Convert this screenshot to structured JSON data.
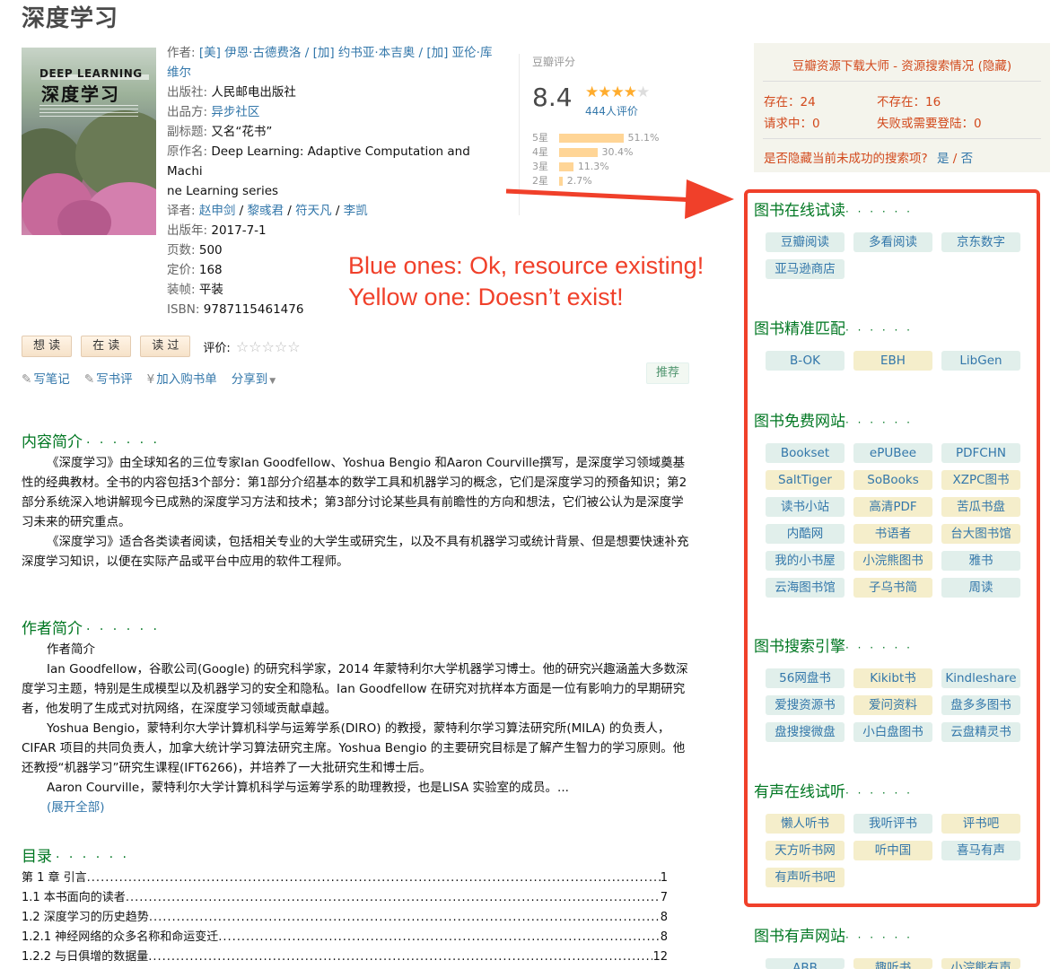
{
  "title": "深度学习",
  "cover": {
    "line1": "DEEP LEARNING",
    "line2": "深度学习"
  },
  "info": {
    "author_label": "作者:",
    "authors": "[美] 伊恩·古德费洛 / [加] 约书亚·本吉奥 / [加] 亚伦·库维尔",
    "authors_line1": "[美] 伊恩·古德费洛 / [加] 约书亚·本吉奥 / [加] 亚伦·库",
    "authors_line2": "维尔",
    "publisher_label": "出版社:",
    "publisher": "人民邮电出版社",
    "producer_label": "出品方:",
    "producer": "异步社区",
    "subtitle_label": "副标题:",
    "subtitle": "又名“花书”",
    "original_label": "原作名:",
    "original_line1": "Deep Learning: Adaptive Computation and Machi",
    "original_line2": "ne Learning series",
    "translator_label": "译者:",
    "translators": [
      "赵申剑",
      "黎彧君",
      "符天凡",
      "李凯"
    ],
    "pubyear_label": "出版年:",
    "pubyear": "2017-7-1",
    "pages_label": "页数:",
    "pages": "500",
    "price_label": "定价:",
    "price": "168",
    "binding_label": "装帧:",
    "binding": "平装",
    "isbn_label": "ISBN:",
    "isbn": "9787115461476"
  },
  "rating": {
    "label": "豆瓣评分",
    "score": "8.4",
    "stars": 4.5,
    "count": "444人评价",
    "bars": [
      {
        "label": "5星",
        "pct": "51.1%",
        "value": 51.1
      },
      {
        "label": "4星",
        "pct": "30.4%",
        "value": 30.4
      },
      {
        "label": "3星",
        "pct": "11.3%",
        "value": 11.3
      },
      {
        "label": "2星",
        "pct": "2.7%",
        "value": 2.7
      }
    ]
  },
  "actions": {
    "want": "想 读",
    "reading": "在 读",
    "read": "读 过",
    "rate": "评价:"
  },
  "tools": {
    "note": "写笔记",
    "review": "写书评",
    "cart": "加入购书单",
    "share": "分享到",
    "recommend": "推荐"
  },
  "intro": {
    "heading": "内容简介",
    "dots": "· · · · · ·",
    "p1": "《深度学习》由全球知名的三位专家Ian Goodfellow、Yoshua Bengio 和Aaron Courville撰写，是深度学习领域奠基性的经典教材。全书的内容包括3个部分：第1部分介绍基本的数学工具和机器学习的概念，它们是深度学习的预备知识；第2部分系统深入地讲解现今已成熟的深度学习方法和技术；第3部分讨论某些具有前瞻性的方向和想法，它们被公认为是深度学习未来的研究重点。",
    "p2": "《深度学习》适合各类读者阅读，包括相关专业的大学生或研究生，以及不具有机器学习或统计背景、但是想要快速补充深度学习知识，以便在实际产品或平台中应用的软件工程师。"
  },
  "author_intro": {
    "heading": "作者简介",
    "dots": "· · · · · ·",
    "sub": "作者简介",
    "p1": "Ian Goodfellow，谷歌公司(Google) 的研究科学家，2014 年蒙特利尔大学机器学习博士。他的研究兴趣涵盖大多数深度学习主题，特别是生成模型以及机器学习的安全和隐私。Ian Goodfellow 在研究对抗样本方面是一位有影响力的早期研究者，他发明了生成式对抗网络，在深度学习领域贡献卓越。",
    "p2": "Yoshua Bengio，蒙特利尔大学计算机科学与运筹学系(DIRO) 的教授，蒙特利尔学习算法研究所(MILA) 的负责人，CIFAR 项目的共同负责人，加拿大统计学习算法研究主席。Yoshua Bengio 的主要研究目标是了解产生智力的学习原则。他还教授“机器学习”研究生课程(IFT6266)，并培养了一大批研究生和博士后。",
    "p3": "Aaron Courville，蒙特利尔大学计算机科学与运筹学系的助理教授，也是LISA 实验室的成员。...",
    "expand": "(展开全部)"
  },
  "toc": {
    "heading": "目录",
    "dots": "· · · · · ·",
    "items": [
      {
        "t": "第 1 章 引言",
        "p": "1"
      },
      {
        "t": "1.1 本书面向的读者",
        "p": "7"
      },
      {
        "t": "1.2 深度学习的历史趋势",
        "p": "8"
      },
      {
        "t": "1.2.1 神经网络的众多名称和命运变迁",
        "p": "8"
      },
      {
        "t": "1.2.2 与日俱增的数据量",
        "p": "12"
      }
    ]
  },
  "annotation": {
    "line1": "Blue ones: Ok, resource existing!",
    "line2": "Yellow one: Doesn’t exist!",
    "color": "#f0402a"
  },
  "panel": {
    "title": "豆瓣资源下载大师 - 资源搜索情况",
    "hide": "(隐藏)",
    "exist": "存在：24",
    "notexist": "不存在：16",
    "requesting": "请求中：0",
    "failed": "失败或需要登陆：0",
    "question": "是否隐藏当前未成功的搜索项?",
    "yes": "是",
    "no": "否"
  },
  "groups": [
    {
      "name": "图书在线试读",
      "tags": [
        {
          "label": "豆瓣阅读",
          "ok": true
        },
        {
          "label": "多看阅读",
          "ok": true
        },
        {
          "label": "京东数字",
          "ok": true
        },
        {
          "label": "亚马逊商店",
          "ok": true
        }
      ]
    },
    {
      "name": "图书精准匹配",
      "tags": [
        {
          "label": "B-OK",
          "ok": true
        },
        {
          "label": "EBH",
          "ok": false
        },
        {
          "label": "LibGen",
          "ok": true
        }
      ]
    },
    {
      "name": "图书免费网站",
      "tags": [
        {
          "label": "Bookset",
          "ok": true
        },
        {
          "label": "ePUBee",
          "ok": true
        },
        {
          "label": "PDFCHN",
          "ok": true
        },
        {
          "label": "SaltTiger",
          "ok": false
        },
        {
          "label": "SoBooks",
          "ok": false
        },
        {
          "label": "XZPC图书",
          "ok": false
        },
        {
          "label": "读书小站",
          "ok": true
        },
        {
          "label": "高清PDF",
          "ok": false
        },
        {
          "label": "苦瓜书盘",
          "ok": false
        },
        {
          "label": "内酷网",
          "ok": true
        },
        {
          "label": "书语者",
          "ok": false
        },
        {
          "label": "台大图书馆",
          "ok": false
        },
        {
          "label": "我的小书屋",
          "ok": true
        },
        {
          "label": "小浣熊图书",
          "ok": false
        },
        {
          "label": "雅书",
          "ok": true
        },
        {
          "label": "云海图书馆",
          "ok": true
        },
        {
          "label": "子乌书简",
          "ok": false
        },
        {
          "label": "周读",
          "ok": true
        }
      ]
    },
    {
      "name": "图书搜索引擎",
      "tags": [
        {
          "label": "56网盘书",
          "ok": true
        },
        {
          "label": "Kikibt书",
          "ok": false
        },
        {
          "label": "Kindleshare",
          "ok": true
        },
        {
          "label": "爱搜资源书",
          "ok": true
        },
        {
          "label": "爱问资料",
          "ok": false
        },
        {
          "label": "盘多多图书",
          "ok": true
        },
        {
          "label": "盘搜搜微盘",
          "ok": true
        },
        {
          "label": "小白盘图书",
          "ok": true
        },
        {
          "label": "云盘精灵书",
          "ok": true
        }
      ]
    },
    {
      "name": "有声在线试听",
      "tags": [
        {
          "label": "懒人听书",
          "ok": false
        },
        {
          "label": "我听评书",
          "ok": true
        },
        {
          "label": "评书吧",
          "ok": false
        },
        {
          "label": "天方听书网",
          "ok": false
        },
        {
          "label": "听中国",
          "ok": false
        },
        {
          "label": "喜马有声",
          "ok": true
        },
        {
          "label": "有声听书吧",
          "ok": false
        }
      ]
    },
    {
      "name": "图书有声网站",
      "tags": [
        {
          "label": "ABB",
          "ok": true
        },
        {
          "label": "趣听书",
          "ok": false
        },
        {
          "label": "小浣熊有声",
          "ok": false
        }
      ]
    }
  ],
  "group_dots": "· · · · · ·",
  "colors": {
    "ok": "#e1efeb",
    "missing": "#f5eecb",
    "green": "#007722",
    "link": "#37a"
  }
}
